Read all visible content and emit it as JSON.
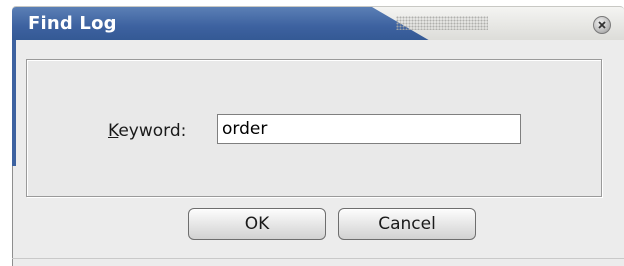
{
  "window": {
    "title": "Find Log"
  },
  "form": {
    "keyword_label_accel": "K",
    "keyword_label_rest": "eyword:",
    "keyword_value": "order"
  },
  "buttons": {
    "ok_label": "OK",
    "cancel_label": "Cancel"
  },
  "icons": {
    "close": "close-icon"
  },
  "colors": {
    "title_bar": "#3d62a0",
    "background": "#ececec"
  }
}
